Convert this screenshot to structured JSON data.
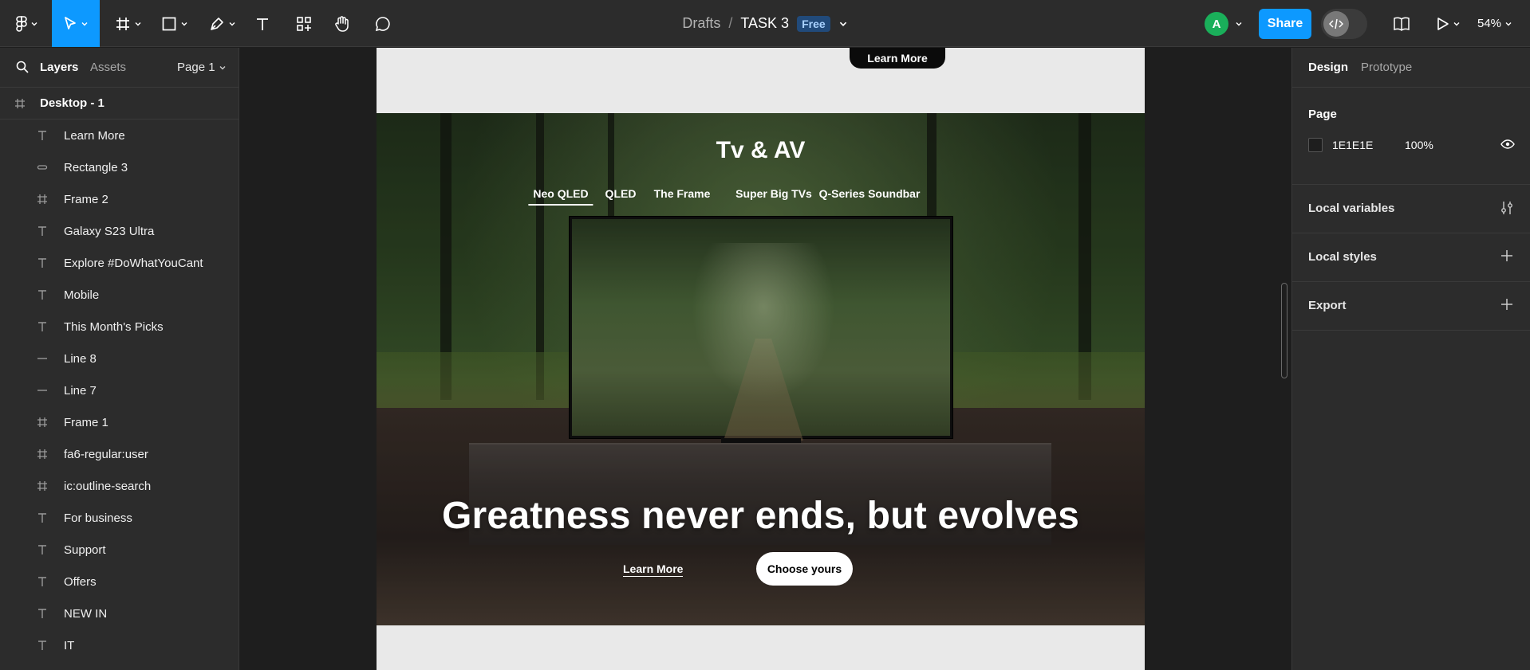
{
  "toolbar": {
    "breadcrumb_drafts": "Drafts",
    "breadcrumb_sep": "/",
    "file_name": "TASK 3",
    "plan_badge": "Free",
    "avatar_initial": "A",
    "share_label": "Share",
    "zoom": "54%"
  },
  "left_panel": {
    "tab_layers": "Layers",
    "tab_assets": "Assets",
    "page_selector": "Page 1",
    "frame_name": "Desktop - 1",
    "layers": [
      {
        "label": "Learn More",
        "icon": "text-icon"
      },
      {
        "label": "Rectangle 3",
        "icon": "rectangle-icon"
      },
      {
        "label": "Frame 2",
        "icon": "frame-icon"
      },
      {
        "label": "Galaxy S23 Ultra",
        "icon": "text-icon"
      },
      {
        "label": "Explore #DoWhatYouCant",
        "icon": "text-icon"
      },
      {
        "label": "Mobile",
        "icon": "text-icon"
      },
      {
        "label": "This Month's Picks",
        "icon": "text-icon"
      },
      {
        "label": "Line 8",
        "icon": "line-icon"
      },
      {
        "label": "Line 7",
        "icon": "line-icon"
      },
      {
        "label": "Frame 1",
        "icon": "frame-icon"
      },
      {
        "label": "fa6-regular:user",
        "icon": "frame-icon"
      },
      {
        "label": "ic:outline-search",
        "icon": "frame-icon"
      },
      {
        "label": "For business",
        "icon": "text-icon"
      },
      {
        "label": "Support",
        "icon": "text-icon"
      },
      {
        "label": "Offers",
        "icon": "text-icon"
      },
      {
        "label": "NEW IN",
        "icon": "text-icon"
      },
      {
        "label": "IT",
        "icon": "text-icon"
      }
    ]
  },
  "canvas": {
    "top_button": "Learn More",
    "hero_title": "Tv & AV",
    "hero_tabs": [
      "Neo QLED",
      "QLED",
      "The Frame",
      "Super Big TVs",
      "Q-Series Soundbar"
    ],
    "selected_tab": "Neo QLED",
    "headline": "Greatness never ends, but evolves",
    "link_learn": "Learn More",
    "btn_choose": "Choose yours"
  },
  "right_panel": {
    "tab_design": "Design",
    "tab_prototype": "Prototype",
    "page_section": "Page",
    "page_color": "1E1E1E",
    "page_opacity": "100%",
    "local_variables": "Local variables",
    "local_styles": "Local styles",
    "export": "Export"
  },
  "colors": {
    "accent": "#0d99ff",
    "panel": "#2c2c2c",
    "canvas": "#1e1e1e",
    "avatar": "#1aaf5a"
  }
}
